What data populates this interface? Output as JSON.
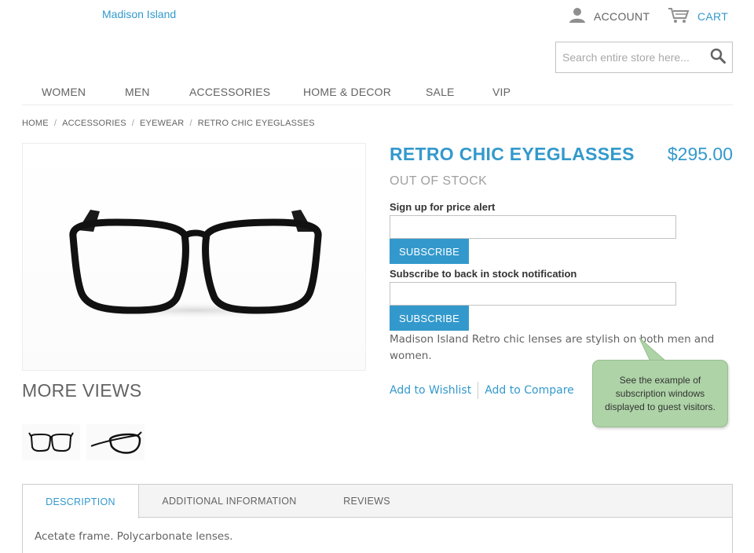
{
  "header": {
    "brand": "Madison Island",
    "account_label": "ACCOUNT",
    "cart_label": "CART",
    "search_placeholder": "Search entire store here..."
  },
  "nav": {
    "items": [
      "WOMEN",
      "MEN",
      "ACCESSORIES",
      "HOME & DECOR",
      "SALE",
      "VIP"
    ]
  },
  "breadcrumb": [
    "HOME",
    "ACCESSORIES",
    "EYEWEAR",
    "RETRO CHIC EYEGLASSES"
  ],
  "product": {
    "name": "RETRO CHIC EYEGLASSES",
    "price": "$295.00",
    "availability": "OUT OF STOCK",
    "description": "Madison Island Retro chic lenses are stylish on both men and women."
  },
  "price_alert": {
    "label": "Sign up for price alert",
    "button": "SUBSCRIBE"
  },
  "stock_alert": {
    "label": "Subscribe to back in stock notification",
    "button": "SUBSCRIBE"
  },
  "links": {
    "wishlist": "Add to Wishlist",
    "compare": "Add to Compare"
  },
  "callout": {
    "text": "See the example of subscription windows displayed to guest visitors."
  },
  "more_views": {
    "title": "MORE VIEWS"
  },
  "tabs": {
    "items": [
      "DESCRIPTION",
      "ADDITIONAL INFORMATION",
      "REVIEWS"
    ],
    "active_content": "Acetate frame. Polycarbonate lenses."
  },
  "colors": {
    "accent": "#3399cc",
    "text": "#636363",
    "callout_bg": "#aed3a7"
  },
  "icons": {
    "account": "person-icon",
    "cart": "cart-icon",
    "search": "search-icon"
  }
}
